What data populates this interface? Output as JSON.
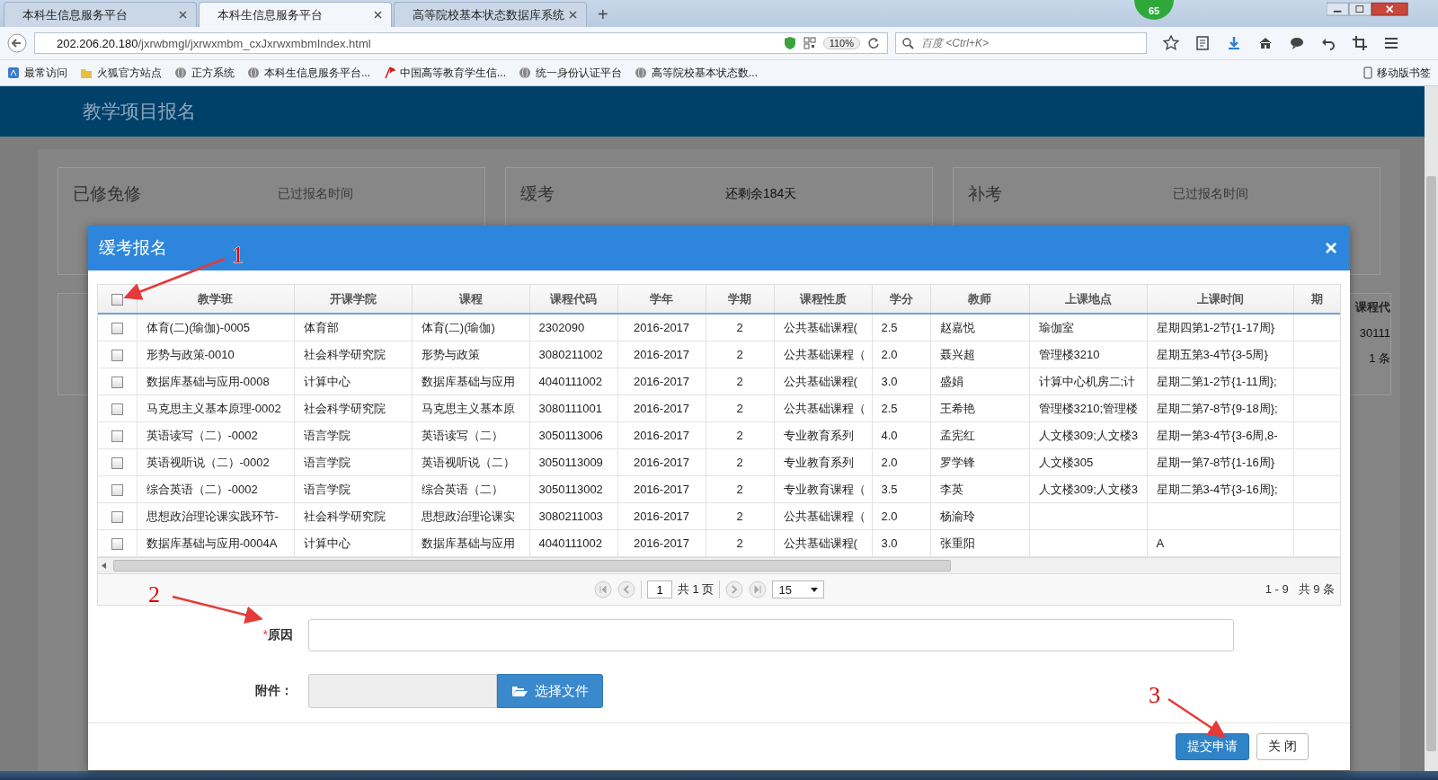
{
  "browser": {
    "tabs": [
      {
        "title": "本科生信息服务平台",
        "selected": false
      },
      {
        "title": "本科生信息服务平台",
        "selected": true
      },
      {
        "title": "高等院校基本状态数据库系统",
        "selected": false
      }
    ],
    "new_tab": "+",
    "badge": "65",
    "url_host": "202.206.20.180",
    "url_path": "/jxrwbmgl/jxrwxmbm_cxJxrwxmbmIndex.html",
    "zoom": "110%",
    "search_placeholder": "百度 <Ctrl+K>",
    "bookmarks": [
      {
        "label": "最常访问",
        "kind": "recent"
      },
      {
        "label": "火狐官方站点",
        "kind": "folder"
      },
      {
        "label": "正方系统",
        "kind": "globe"
      },
      {
        "label": "本科生信息服务平台...",
        "kind": "globe"
      },
      {
        "label": "中国高等教育学生信...",
        "kind": "flag"
      },
      {
        "label": "统一身份认证平台",
        "kind": "globe"
      },
      {
        "label": "高等院校基本状态数...",
        "kind": "globe"
      }
    ],
    "mobile_bookmarks": "移动版书签"
  },
  "page": {
    "title": "教学项目报名",
    "cards": [
      {
        "title": "已修免修",
        "status": "已过报名时间",
        "open": false
      },
      {
        "title": "缓考",
        "status": "还剩余184天",
        "open": true
      },
      {
        "title": "补考",
        "status": "已过报名时间",
        "open": false
      }
    ],
    "hidden_table": {
      "header": "课程代",
      "cell": "30111",
      "count": "1 条"
    }
  },
  "modal": {
    "title": "缓考报名",
    "close": "×",
    "table": {
      "select_all": {
        "checked": false
      },
      "columns": [
        "教学班",
        "开课学院",
        "课程",
        "课程代码",
        "学年",
        "学期",
        "课程性质",
        "学分",
        "教师",
        "上课地点",
        "上课时间",
        "期"
      ],
      "rows": [
        {
          "checked": false,
          "cells": [
            "体育(二)(瑜伽)-0005",
            "体育部",
            "体育(二)(瑜伽)",
            "2302090",
            "2016-2017",
            "2",
            "公共基础课程(",
            "2.5",
            "赵嘉悦",
            "瑜伽室",
            "星期四第1-2节{1-17周}",
            null
          ]
        },
        {
          "checked": false,
          "cells": [
            "形势与政策-0010",
            "社会科学研究院",
            "形势与政策",
            "3080211002",
            "2016-2017",
            "2",
            "公共基础课程（",
            "2.0",
            "聂兴超",
            "管理楼3210",
            "星期五第3-4节{3-5周}",
            null
          ]
        },
        {
          "checked": false,
          "cells": [
            "数据库基础与应用-0008",
            "计算中心",
            "数据库基础与应用",
            "4040111002",
            "2016-2017",
            "2",
            "公共基础课程(",
            "3.0",
            "盛娟",
            "计算中心机房二;计",
            "星期二第1-2节{1-11周};",
            null
          ]
        },
        {
          "checked": false,
          "cells": [
            "马克思主义基本原理-0002",
            "社会科学研究院",
            "马克思主义基本原",
            "3080111001",
            "2016-2017",
            "2",
            "公共基础课程（",
            "2.5",
            "王希艳",
            "管理楼3210;管理楼",
            "星期二第7-8节{9-18周};",
            null
          ]
        },
        {
          "checked": false,
          "cells": [
            "英语读写（二）-0002",
            "语言学院",
            "英语读写（二）",
            "3050113006",
            "2016-2017",
            "2",
            "专业教育系列",
            "4.0",
            "孟宪红",
            "人文楼309;人文楼3",
            "星期一第3-4节{3-6周,8-",
            null
          ]
        },
        {
          "checked": false,
          "cells": [
            "英语视听说（二）-0002",
            "语言学院",
            "英语视听说（二）",
            "3050113009",
            "2016-2017",
            "2",
            "专业教育系列",
            "2.0",
            "罗学锋",
            "人文楼305",
            "星期一第7-8节{1-16周}",
            null
          ]
        },
        {
          "checked": false,
          "cells": [
            "综合英语（二）-0002",
            "语言学院",
            "综合英语（二）",
            "3050113002",
            "2016-2017",
            "2",
            "专业教育课程（",
            "3.5",
            "李英",
            "人文楼309;人文楼3",
            "星期二第3-4节{3-16周};",
            null
          ]
        },
        {
          "checked": false,
          "cells": [
            "思想政治理论课实践环节-",
            "社会科学研究院",
            "思想政治理论课实",
            "3080211003",
            "2016-2017",
            "2",
            "公共基础课程（",
            "2.0",
            "杨渝玲",
            null,
            null,
            null
          ]
        },
        {
          "checked": false,
          "cells": [
            "数据库基础与应用-0004A",
            "计算中心",
            "数据库基础与应用",
            "4040111002",
            "2016-2017",
            "2",
            "公共基础课程(",
            "3.0",
            "张重阳",
            null,
            "A",
            null
          ]
        }
      ]
    },
    "pager": {
      "page": "1",
      "total_pages": "共 1 页",
      "page_size": "15",
      "summary": "1 - 9   共 9 条"
    },
    "form": {
      "reason": {
        "required_mark": "*",
        "label": "原因"
      },
      "attachment": {
        "label": "附件：",
        "button": "选择文件"
      }
    },
    "buttons": [
      {
        "label": "提交申请",
        "kind": "primary"
      },
      {
        "label": "关 闭",
        "kind": "default"
      }
    ]
  },
  "annotations": [
    {
      "number": "1"
    },
    {
      "number": "2"
    },
    {
      "number": "3"
    }
  ]
}
